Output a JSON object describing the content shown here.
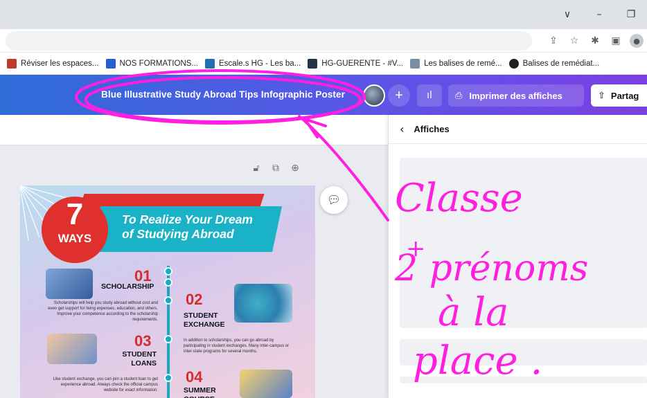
{
  "window": {
    "restore_glyph": "∨",
    "minimize_glyph": "–",
    "maximize_glyph": "❐"
  },
  "toolbar_icons": [
    "share-icon",
    "star-icon",
    "extensions-icon",
    "sidepanel-icon",
    "profile-icon"
  ],
  "bookmarks": [
    {
      "label": "Réviser les espaces...",
      "color": "#c0392b"
    },
    {
      "label": "NOS FORMATIONS...",
      "color": "#2a5bd7"
    },
    {
      "label": "Escale.s HG - Les ba...",
      "color": "#1f6fb2"
    },
    {
      "label": "HG-GUERENTE - #V...",
      "color": "#243447"
    },
    {
      "label": "Les balises de remé...",
      "color": "#7a8fa6"
    },
    {
      "label": "Balises de remédiat...",
      "color": "#222222"
    }
  ],
  "header": {
    "doc_title": "Blue Illustrative Study Abroad Tips Infographic Poster",
    "plus_glyph": "+",
    "print_label": "Imprimer des affiches",
    "share_label": "Partag"
  },
  "panel": {
    "title": "Affiches"
  },
  "poster": {
    "ways_number": "7",
    "ways_label": "WAYS",
    "banner_line1": "To Realize Your Dream",
    "banner_line2": "of Studying Abroad",
    "steps": [
      {
        "num": "01",
        "title": "SCHOLARSHIP",
        "text": "Scholarships will help you study abroad without cost and even get support for living expenses, education, and others. Improve your competence according to the scholarship requirements."
      },
      {
        "num": "02",
        "title": "STUDENT\nEXCHANGE",
        "text": "In addition to scholarships, you can go abroad by participating in student exchanges. Many inter-campus or inter-state programs for several months."
      },
      {
        "num": "03",
        "title": "STUDENT\nLOANS",
        "text": "Like student exchange, you can join a student loan to get experience abroad. Always check the official campus website for exact information."
      },
      {
        "num": "04",
        "title": "SUMMER\nCOURSE",
        "text": ""
      }
    ]
  },
  "annotation": {
    "color": "#ff1fe0",
    "lines": [
      "Classe",
      "+",
      "2 prénoms",
      "à la",
      "place ."
    ]
  }
}
